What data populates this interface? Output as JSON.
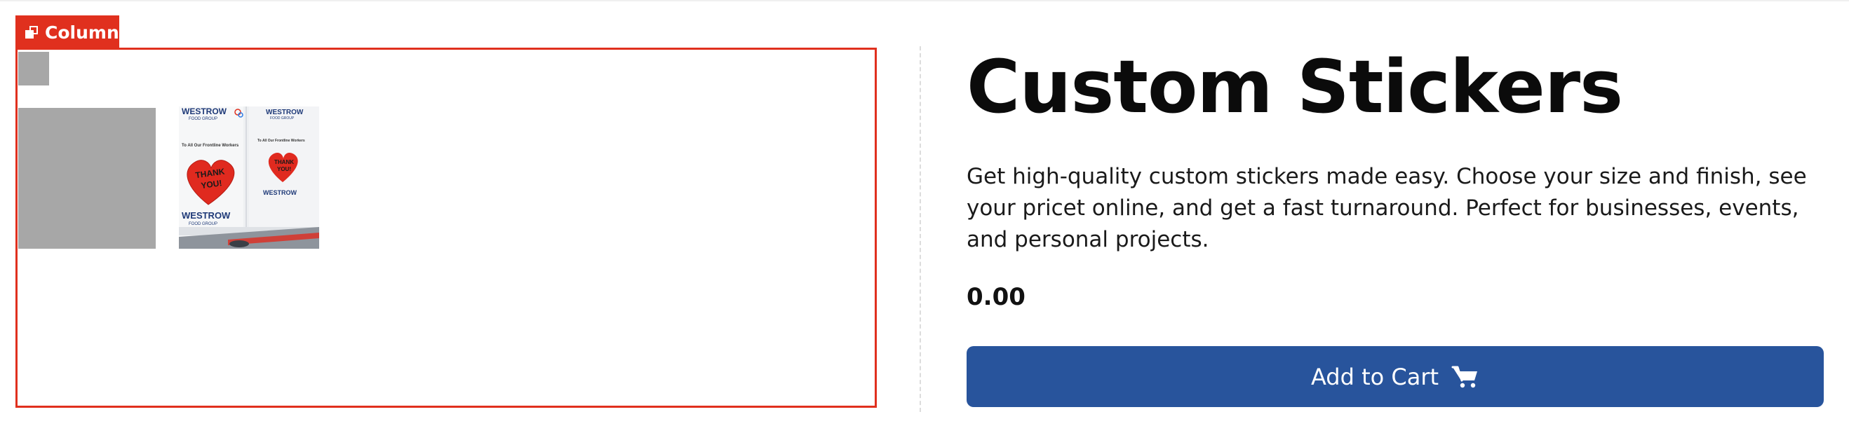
{
  "editor": {
    "column_badge_label": "Column",
    "column_badge_icon": "columns-icon",
    "accent_color": "#e0301e"
  },
  "gallery": {
    "photo_texts": {
      "brand": "WESTROW",
      "brand_sub": "FOOD GROUP",
      "caption": "To All Our Frontline Workers",
      "heart_text_1": "THANK",
      "heart_text_2": "YOU!"
    }
  },
  "product": {
    "title": "Custom Stickers",
    "description": "Get high-quality custom stickers made easy. Choose your size and finish, see your pricet online, and get a fast turnaround. Perfect for businesses, events, and personal projects.",
    "price": "0.00",
    "add_to_cart_label": "Add to Cart",
    "add_to_cart_icon": "cart-icon",
    "button_color": "#28549c"
  }
}
